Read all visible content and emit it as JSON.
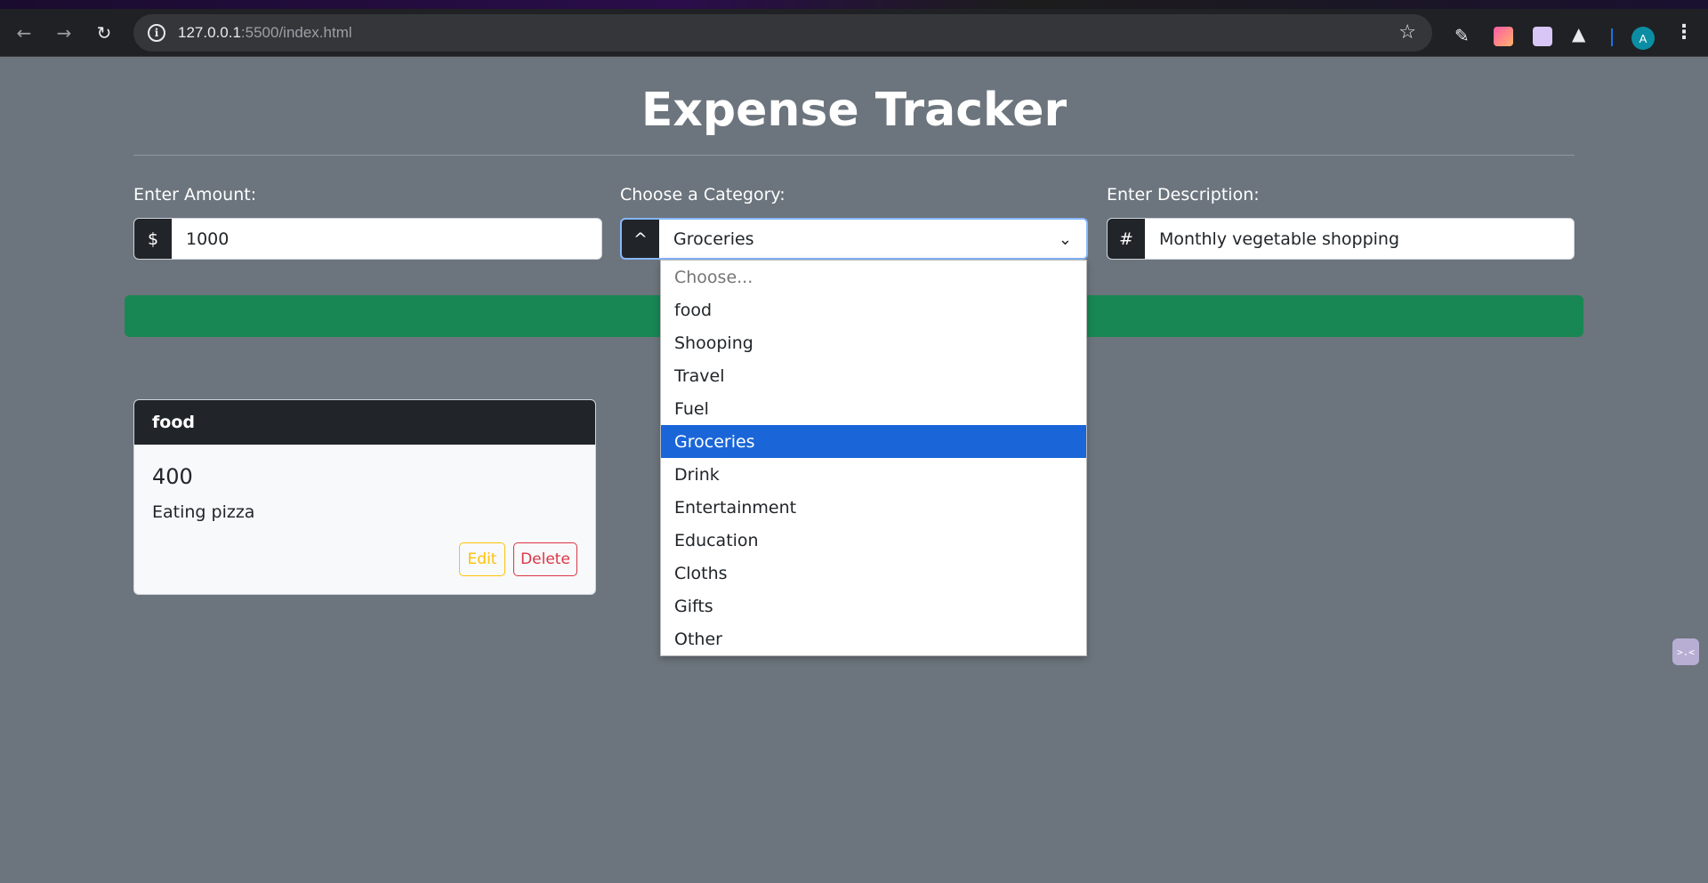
{
  "browser": {
    "url_host": "127.0.0.1",
    "url_rest": ":5500/index.html",
    "avatar_letter": "A"
  },
  "page": {
    "title": "Expense Tracker",
    "amount": {
      "label": "Enter Amount:",
      "addon": "$",
      "value": "1000"
    },
    "category": {
      "label": "Choose a Category:",
      "addon": "^",
      "selected": "Groceries",
      "options": [
        {
          "text": "Choose...",
          "state": "placeholder"
        },
        {
          "text": "food",
          "state": ""
        },
        {
          "text": "Shooping",
          "state": ""
        },
        {
          "text": "Travel",
          "state": ""
        },
        {
          "text": "Fuel",
          "state": ""
        },
        {
          "text": "Groceries",
          "state": "selected"
        },
        {
          "text": "Drink",
          "state": ""
        },
        {
          "text": "Entertainment",
          "state": ""
        },
        {
          "text": "Education",
          "state": ""
        },
        {
          "text": "Cloths",
          "state": ""
        },
        {
          "text": "Gifts",
          "state": ""
        },
        {
          "text": "Other",
          "state": ""
        }
      ]
    },
    "description": {
      "label": "Enter Description:",
      "addon": "#",
      "value": "Monthly vegetable shopping"
    }
  },
  "expenses": [
    {
      "category": "food",
      "amount": "400",
      "description": "Eating pizza",
      "edit_label": "Edit",
      "delete_label": "Delete"
    }
  ],
  "colors": {
    "page_bg": "#6c757d",
    "add_button": "#198754",
    "selected_option": "#1a66d8",
    "edit": "#ffc107",
    "delete": "#dc3545"
  }
}
